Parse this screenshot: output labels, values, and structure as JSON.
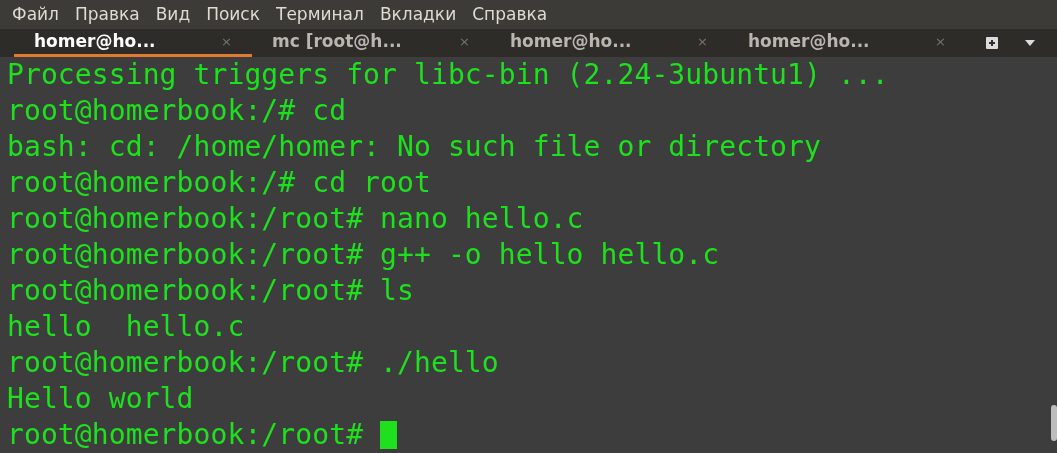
{
  "menu": [
    "Файл",
    "Правка",
    "Вид",
    "Поиск",
    "Терминал",
    "Вкладки",
    "Справка"
  ],
  "tabs": [
    {
      "label": "homer@ho...",
      "close": "×",
      "selected": true
    },
    {
      "label": "mc [root@h...",
      "close": "×",
      "selected": false
    },
    {
      "label": "homer@ho...",
      "close": "×",
      "selected": false
    },
    {
      "label": "homer@ho...",
      "close": "×",
      "selected": false
    }
  ],
  "terminal": {
    "lines": [
      "Processing triggers for libc-bin (2.24-3ubuntu1) ...",
      "root@homerbook:/# cd",
      "bash: cd: /home/homer: No such file or directory",
      "root@homerbook:/# cd root",
      "root@homerbook:/root# nano hello.c",
      "root@homerbook:/root# g++ -o hello hello.c",
      "root@homerbook:/root# ls",
      "hello  hello.c",
      "root@homerbook:/root# ./hello",
      "Hello world",
      "root@homerbook:/root# "
    ],
    "cursor": true
  }
}
